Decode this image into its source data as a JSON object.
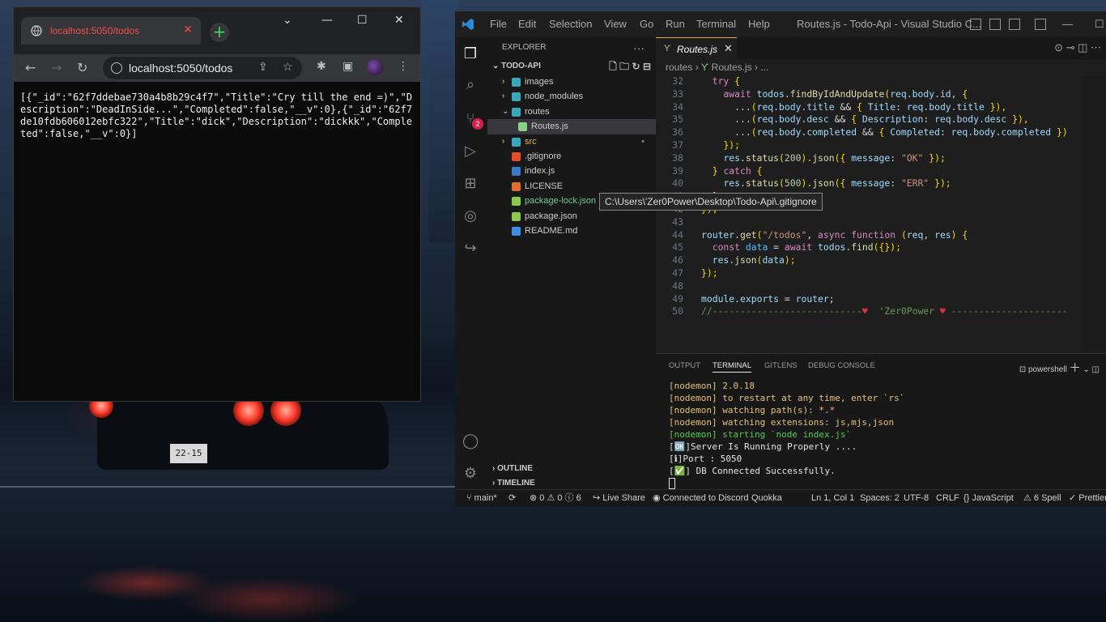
{
  "chrome": {
    "tab_title": "localhost:5050/todos",
    "url": "localhost:5050/todos",
    "body_text": "[{\"_id\":\"62f7ddebae730a4b8b29c4f7\",\"Title\":\"Cry till the end =)\",\"Description\":\"DeadInSide...\",\"Completed\":false,\"__v\":0},{\"_id\":\"62f7de10fdb606012ebfc322\",\"Title\":\"dick\",\"Description\":\"dickkk\",\"Completed\":false,\"__v\":0}]"
  },
  "vscode": {
    "menu": [
      "File",
      "Edit",
      "Selection",
      "View",
      "Go",
      "Run",
      "Terminal",
      "Help"
    ],
    "window_title": "Routes.js - Todo-Api - Visual Studio C...",
    "explorer_label": "EXPLORER",
    "project": "TODO-API",
    "scm_badge": "2",
    "tree": [
      {
        "label": "images",
        "type": "folder",
        "status": ""
      },
      {
        "label": "node_modules",
        "type": "folder",
        "status": ""
      },
      {
        "label": "routes",
        "type": "folder-open",
        "status": ""
      },
      {
        "label": "Routes.js",
        "type": "file-route",
        "status": ""
      },
      {
        "label": "src",
        "type": "folder",
        "status": "•"
      },
      {
        "label": ".gitignore",
        "type": "git",
        "status": ""
      },
      {
        "label": "index.js",
        "type": "js",
        "status": ""
      },
      {
        "label": "LICENSE",
        "type": "license",
        "status": ""
      },
      {
        "label": "package-lock.json",
        "type": "node",
        "status": "U"
      },
      {
        "label": "package.json",
        "type": "node",
        "status": ""
      },
      {
        "label": "README.md",
        "type": "info",
        "status": ""
      }
    ],
    "tooltip": "C:\\Users\\'Zer0Power\\Desktop\\Todo-Api\\.gitignore",
    "outline_label": "OUTLINE",
    "timeline_label": "TIMELINE",
    "editor_tab": "Routes.js",
    "breadcrumb": [
      "routes",
      "Routes.js",
      "..."
    ],
    "line_numbers": [
      "32",
      "33",
      "34",
      "35",
      "36",
      "37",
      "38",
      "39",
      "40",
      "41",
      "42",
      "43",
      "44",
      "45",
      "46",
      "47",
      "48",
      "49",
      "50"
    ],
    "panel_tabs": [
      "OUTPUT",
      "TERMINAL",
      "GITLENS",
      "DEBUG CONSOLE"
    ],
    "shell": "powershell",
    "terminal": [
      {
        "text": "[nodemon] 2.0.18",
        "color": "yellow"
      },
      {
        "text": "[nodemon] to restart at any time, enter `rs`",
        "color": "yellow"
      },
      {
        "text": "[nodemon] watching path(s): *.*",
        "color": "yellow"
      },
      {
        "text": "[nodemon] watching extensions: js,mjs,json",
        "color": "yellow"
      },
      {
        "text": "[nodemon] starting `node index.js`",
        "color": "green"
      },
      {
        "text": "[🆗]Server Is Running Properly ....",
        "color": "white"
      },
      {
        "text": "[ℹ]Port : 5050",
        "color": "white"
      },
      {
        "text": "[✅] DB Connected Successfully.",
        "color": "white"
      }
    ],
    "status": {
      "branch": "main*",
      "problems": "⊗ 0 ⚠ 0 ⓘ 6",
      "live_share": "Live Share",
      "discord": "Connected to Discord",
      "quokka": "Quokka",
      "position": "Ln 1, Col 1",
      "spaces": "Spaces: 2",
      "encoding": "UTF-8",
      "eol": "CRLF",
      "language": "JavaScript",
      "spell": "6 Spell",
      "prettier": "Prettier"
    }
  }
}
